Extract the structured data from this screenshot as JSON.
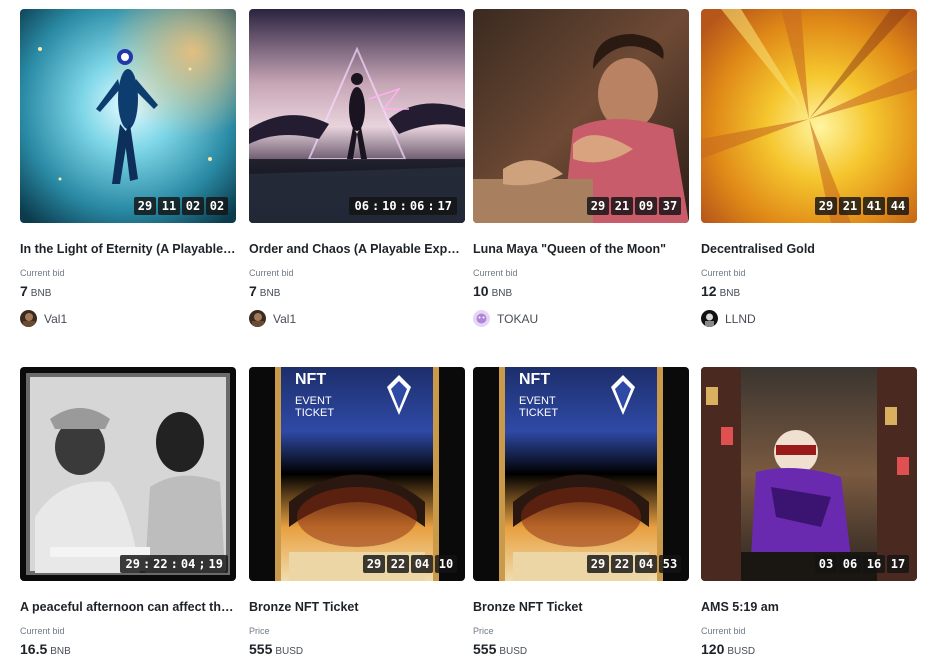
{
  "labels": {
    "current_bid": "Current bid",
    "price": "Price"
  },
  "cards": [
    {
      "title": "In the Light of Eternity (A Playable Ex...",
      "price_label": "Current bid",
      "price": "7",
      "currency": "BNB",
      "creator": "Val1",
      "timer": [
        "29",
        "11",
        "02",
        "02"
      ]
    },
    {
      "title": "Order and Chaos (A Playable Experie...",
      "price_label": "Current bid",
      "price": "7",
      "currency": "BNB",
      "creator": "Val1",
      "timer": [
        "06",
        "10",
        "06",
        "17"
      ]
    },
    {
      "title": "Luna Maya \"Queen of the Moon\"",
      "price_label": "Current bid",
      "price": "10",
      "currency": "BNB",
      "creator": "TOKAU",
      "timer": [
        "29",
        "21",
        "09",
        "37"
      ]
    },
    {
      "title": "Decentralised Gold",
      "price_label": "Current bid",
      "price": "12",
      "currency": "BNB",
      "creator": "LLND",
      "timer": [
        "29",
        "21",
        "41",
        "44"
      ]
    },
    {
      "title": "A peaceful afternoon can affect the w...",
      "price_label": "Current bid",
      "price": "16.5",
      "currency": "BNB",
      "timer": [
        "29",
        "22",
        "04",
        "19"
      ]
    },
    {
      "title": "Bronze NFT Ticket",
      "price_label": "Price",
      "price": "555",
      "currency": "BUSD",
      "timer": [
        "29",
        "22",
        "04",
        "10"
      ],
      "ticket": {
        "nft": "NFT",
        "line1": "EVENT",
        "line2": "TICKET"
      }
    },
    {
      "title": "Bronze NFT Ticket",
      "price_label": "Price",
      "price": "555",
      "currency": "BUSD",
      "timer": [
        "29",
        "22",
        "04",
        "53"
      ],
      "ticket": {
        "nft": "NFT",
        "line1": "EVENT",
        "line2": "TICKET"
      }
    },
    {
      "title": "AMS 5:19 am",
      "price_label": "Current bid",
      "price": "120",
      "currency": "BUSD",
      "timer": [
        "03",
        "06",
        "16",
        "17"
      ]
    }
  ],
  "icons": [
    "clock-timer",
    "creator-avatar",
    "club-crest-icon"
  ],
  "colors": {
    "text": "#1e2329",
    "muted": "#707a8a",
    "timer_bg": "#141414"
  }
}
